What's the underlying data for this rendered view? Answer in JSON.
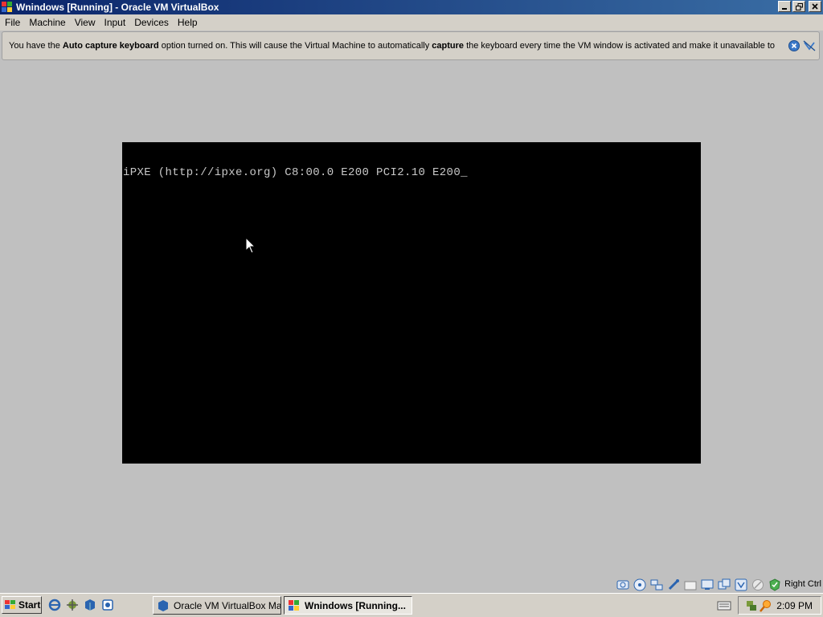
{
  "window": {
    "title": "Wnindows  [Running] - Oracle VM VirtualBox",
    "controls": [
      "minimize",
      "restore",
      "close"
    ]
  },
  "menu": [
    "File",
    "Machine",
    "View",
    "Input",
    "Devices",
    "Help"
  ],
  "notice": {
    "part1": "You have the ",
    "bold1": "Auto capture keyboard",
    "part2": " option turned on. This will cause the Virtual Machine to automatically ",
    "bold2": "capture",
    "part3": " the keyboard every time the VM window is activated and make it unavailable to"
  },
  "vm": {
    "console_line": "iPXE (http://ipxe.org) C8:00.0 E200 PCI2.10 E200_"
  },
  "statusbar": {
    "icons": [
      "hard-disk-icon",
      "optical-drive-icon",
      "network-icon",
      "usb-icon",
      "shared-folders-icon",
      "display-icon",
      "video-capture-icon",
      "virtualization-icon",
      "mouse-integration-icon",
      "host-key-status-icon"
    ],
    "host_key": "Right Ctrl"
  },
  "taskbar": {
    "start_label": "Start",
    "tasks": [
      {
        "label": "Oracle VM VirtualBox Ma...",
        "active": false
      },
      {
        "label": "Wnindows  [Running...",
        "active": true
      }
    ],
    "clock": "2:09 PM"
  },
  "colors": {
    "titlebar_start": "#0a246a",
    "titlebar_end": "#3a6ea5",
    "chrome": "#d4d0c8",
    "vm_background": "#000000",
    "console_text": "#c8c8c8"
  }
}
